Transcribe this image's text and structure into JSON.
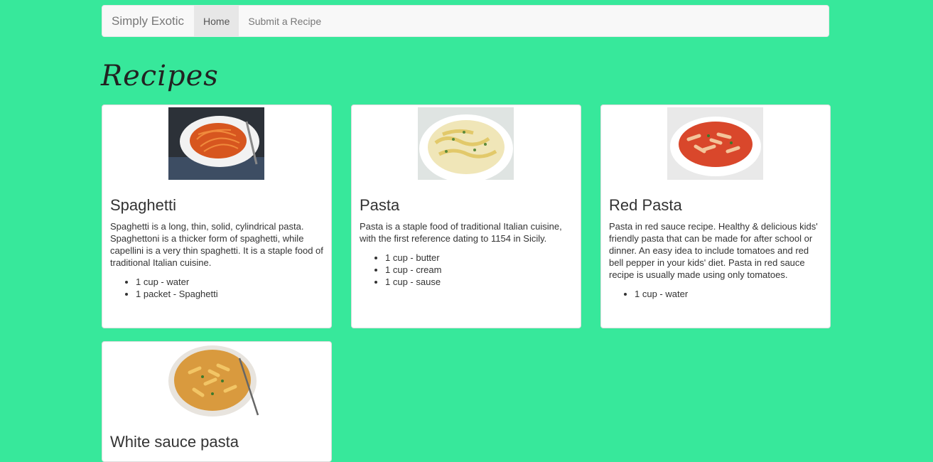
{
  "navbar": {
    "brand": "Simply Exotic",
    "links": [
      {
        "label": "Home",
        "active": true
      },
      {
        "label": "Submit a Recipe",
        "active": false
      }
    ]
  },
  "page": {
    "title": "Recipes"
  },
  "colors": {
    "background": "#37e89b",
    "card": "#ffffff",
    "navbar": "#f8f8f8"
  },
  "recipes": [
    {
      "title": "Spaghetti",
      "description": "Spaghetti is a long, thin, solid, cylindrical pasta. Spaghettoni is a thicker form of spaghetti, while capellini is a very thin spaghetti. It is a staple food of traditional Italian cuisine.",
      "ingredients": [
        "1 cup - water",
        "1 packet - Spaghetti"
      ]
    },
    {
      "title": "Pasta",
      "description": "Pasta is a staple food of traditional Italian cuisine, with the first reference dating to 1154 in Sicily.",
      "ingredients": [
        "1 cup - butter",
        "1 cup - cream",
        "1 cup - sause"
      ]
    },
    {
      "title": "Red Pasta",
      "description": "Pasta in red sauce recipe. Healthy & delicious kids' friendly pasta that can be made for after school or dinner. An easy idea to include tomatoes and red bell pepper in your kids' diet. Pasta in red sauce recipe is usually made using only tomatoes.",
      "ingredients": [
        "1 cup - water"
      ]
    },
    {
      "title": "White sauce pasta",
      "description": "",
      "ingredients": []
    }
  ]
}
